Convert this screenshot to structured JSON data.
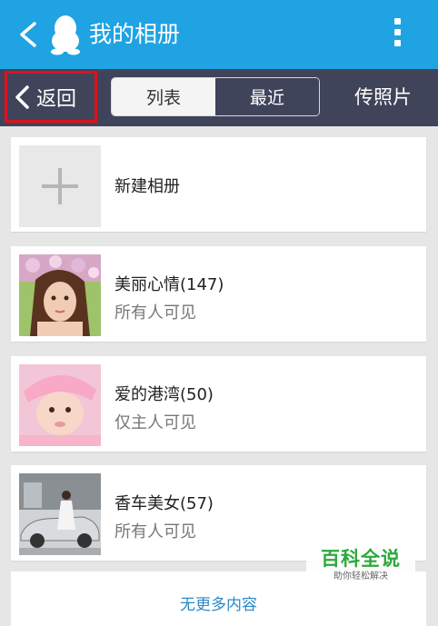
{
  "header": {
    "title": "我的相册",
    "back_icon": "chevron-left-icon",
    "logo_icon": "qq-penguin-icon",
    "more_icon": "more-vertical-icon"
  },
  "toolbar": {
    "back_label": "返回",
    "segments": [
      "列表",
      "最近"
    ],
    "selected_segment": "列表",
    "upload_label": "传照片"
  },
  "albums": [
    {
      "name": "新建相册",
      "thumb": "plus-icon"
    },
    {
      "name": "美丽心情(147)",
      "privacy": "所有人可见"
    },
    {
      "name": "爱的港湾(50)",
      "privacy": "仅主人可见"
    },
    {
      "name": "香车美女(57)",
      "privacy": "所有人可见"
    }
  ],
  "footer": {
    "more_text": "无更多内容"
  },
  "watermark": {
    "title": "百科全说",
    "subtitle": "助你轻松解决"
  },
  "colors": {
    "title_bar": "#1fa3e3",
    "sub_bar": "#40445a",
    "highlight_box": "#e0101a",
    "link": "#2a8ac8"
  }
}
